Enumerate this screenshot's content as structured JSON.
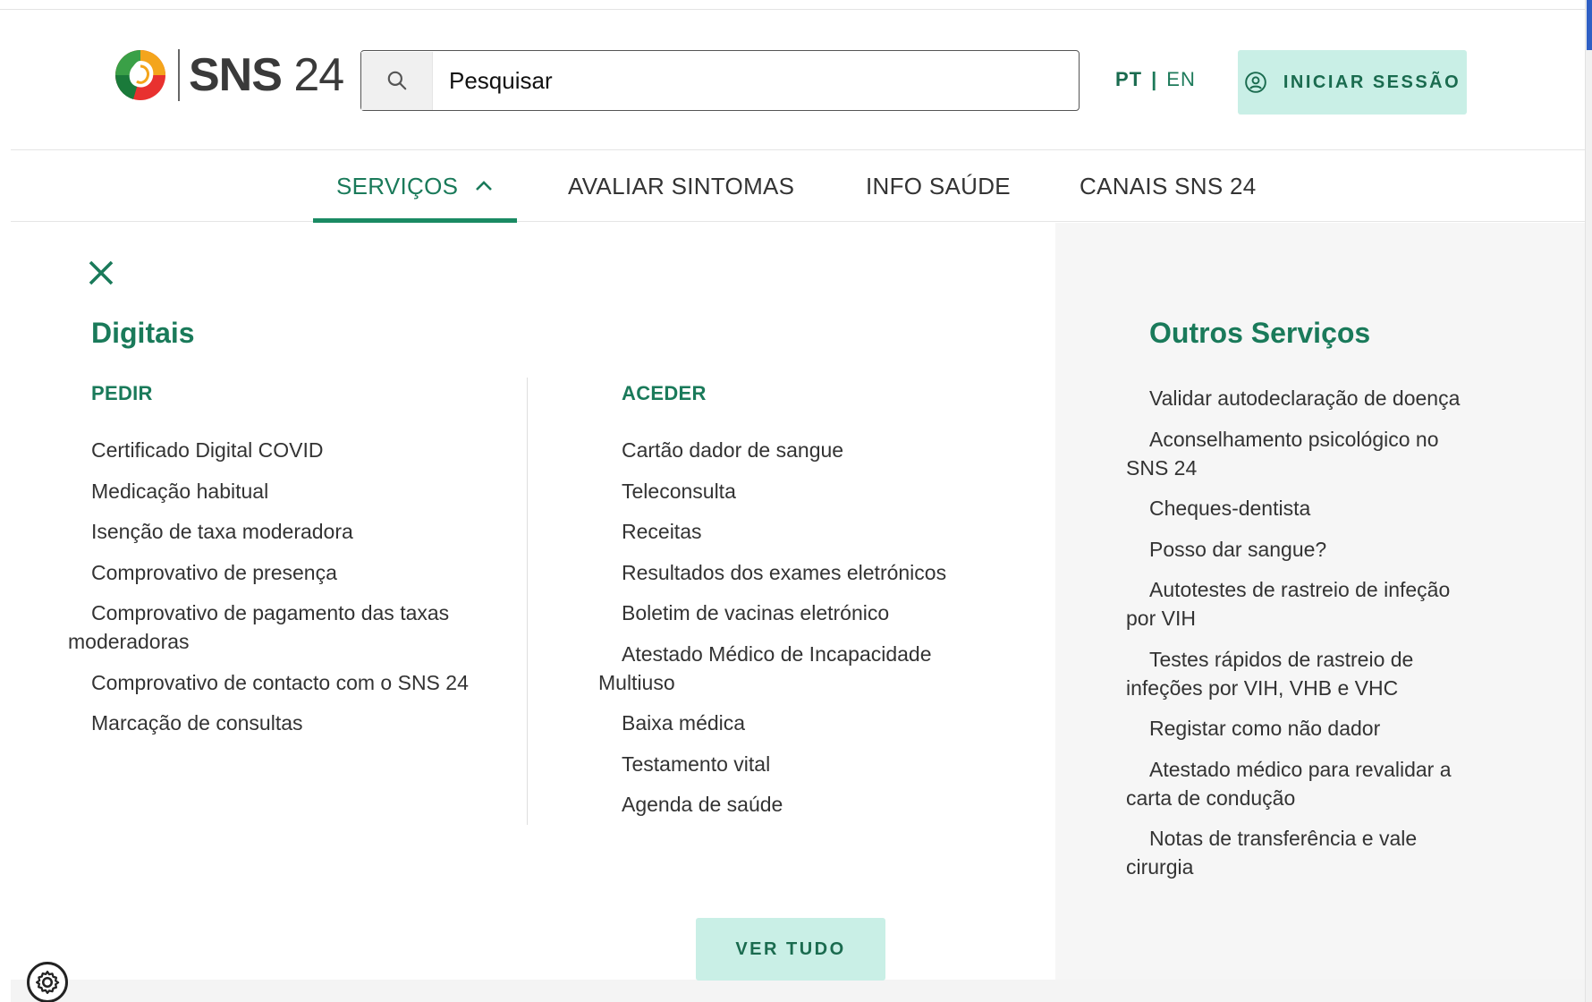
{
  "header": {
    "logo": {
      "bold": "SNS",
      "light": " 24"
    },
    "search": {
      "placeholder": "Pesquisar"
    },
    "lang": {
      "pt": "PT",
      "separator": "|",
      "en": "EN"
    },
    "login_label": "INICIAR SESSÃO"
  },
  "nav": {
    "items": [
      {
        "label": "SERVIÇOS",
        "active": true
      },
      {
        "label": "AVALIAR SINTOMAS"
      },
      {
        "label": "INFO SAÚDE"
      },
      {
        "label": "CANAIS SNS 24"
      }
    ]
  },
  "menu": {
    "digitais": {
      "title": "Digitais",
      "pedir": {
        "title": "PEDIR",
        "items": [
          "Certificado Digital COVID",
          "Medicação habitual",
          "Isenção de taxa moderadora",
          "Comprovativo de presença",
          "Comprovativo de pagamento das taxas moderadoras",
          "Comprovativo de contacto com o SNS 24",
          "Marcação de consultas"
        ]
      },
      "aceder": {
        "title": "ACEDER",
        "items": [
          "Cartão dador de sangue",
          "Teleconsulta",
          "Receitas",
          "Resultados dos exames eletrónicos",
          "Boletim de vacinas eletrónico",
          "Atestado Médico de Incapacidade Multiuso",
          "Baixa médica",
          "Testamento vital",
          "Agenda de saúde"
        ]
      }
    },
    "outros": {
      "title": "Outros Serviços",
      "items": [
        "Validar autodeclaração de doença",
        "Aconselhamento psicológico no SNS 24",
        "Cheques-dentista",
        "Posso dar sangue?",
        "Autotestes de rastreio de infeção por VIH",
        "Testes rápidos de rastreio de infeções por VIH, VHB e VHC",
        "Registar como não dador",
        "Atestado médico para revalidar a carta de condução",
        "Notas de transferência e vale cirurgia"
      ]
    },
    "ver_tudo": "VER TUDO"
  },
  "colors": {
    "brand_green": "#1a7a5a",
    "button_bg": "#c9efe6",
    "panel_gray": "#f6f6f6"
  },
  "icons": {
    "search": "search-icon",
    "user": "user-circle-icon",
    "chevron": "chevron-up-icon",
    "close": "close-icon",
    "settings": "gear-icon"
  }
}
